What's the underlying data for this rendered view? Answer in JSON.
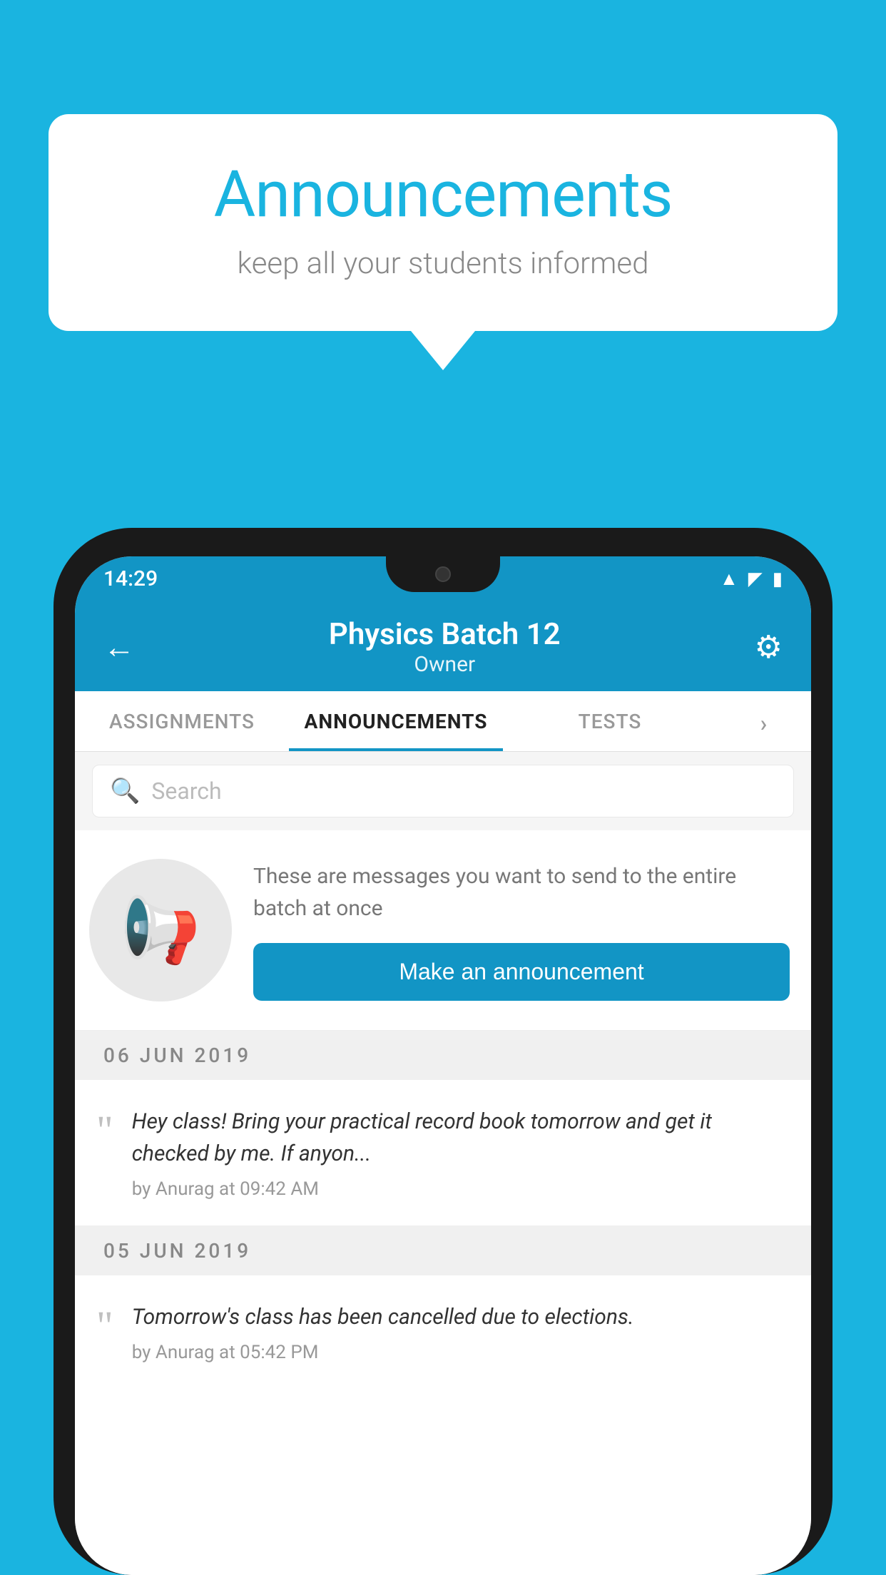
{
  "background_color": "#1ab4e0",
  "speech_bubble": {
    "title": "Announcements",
    "subtitle": "keep all your students informed"
  },
  "phone": {
    "status_bar": {
      "time": "14:29",
      "wifi_icon": "▲",
      "signal_icon": "▲",
      "battery_icon": "▮"
    },
    "header": {
      "back_label": "←",
      "title": "Physics Batch 12",
      "subtitle": "Owner",
      "gear_icon": "⚙"
    },
    "tabs": [
      {
        "label": "ASSIGNMENTS",
        "active": false
      },
      {
        "label": "ANNOUNCEMENTS",
        "active": true
      },
      {
        "label": "TESTS",
        "active": false
      },
      {
        "label": "›",
        "active": false
      }
    ],
    "search": {
      "placeholder": "Search"
    },
    "promo": {
      "description": "These are messages you want to send to the entire batch at once",
      "button_label": "Make an announcement"
    },
    "announcements": [
      {
        "date": "06  JUN  2019",
        "message": "Hey class! Bring your practical record book tomorrow and get it checked by me. If anyon...",
        "meta": "by Anurag at 09:42 AM"
      },
      {
        "date": "05  JUN  2019",
        "message": "Tomorrow's class has been cancelled due to elections.",
        "meta": "by Anurag at 05:42 PM"
      }
    ]
  }
}
